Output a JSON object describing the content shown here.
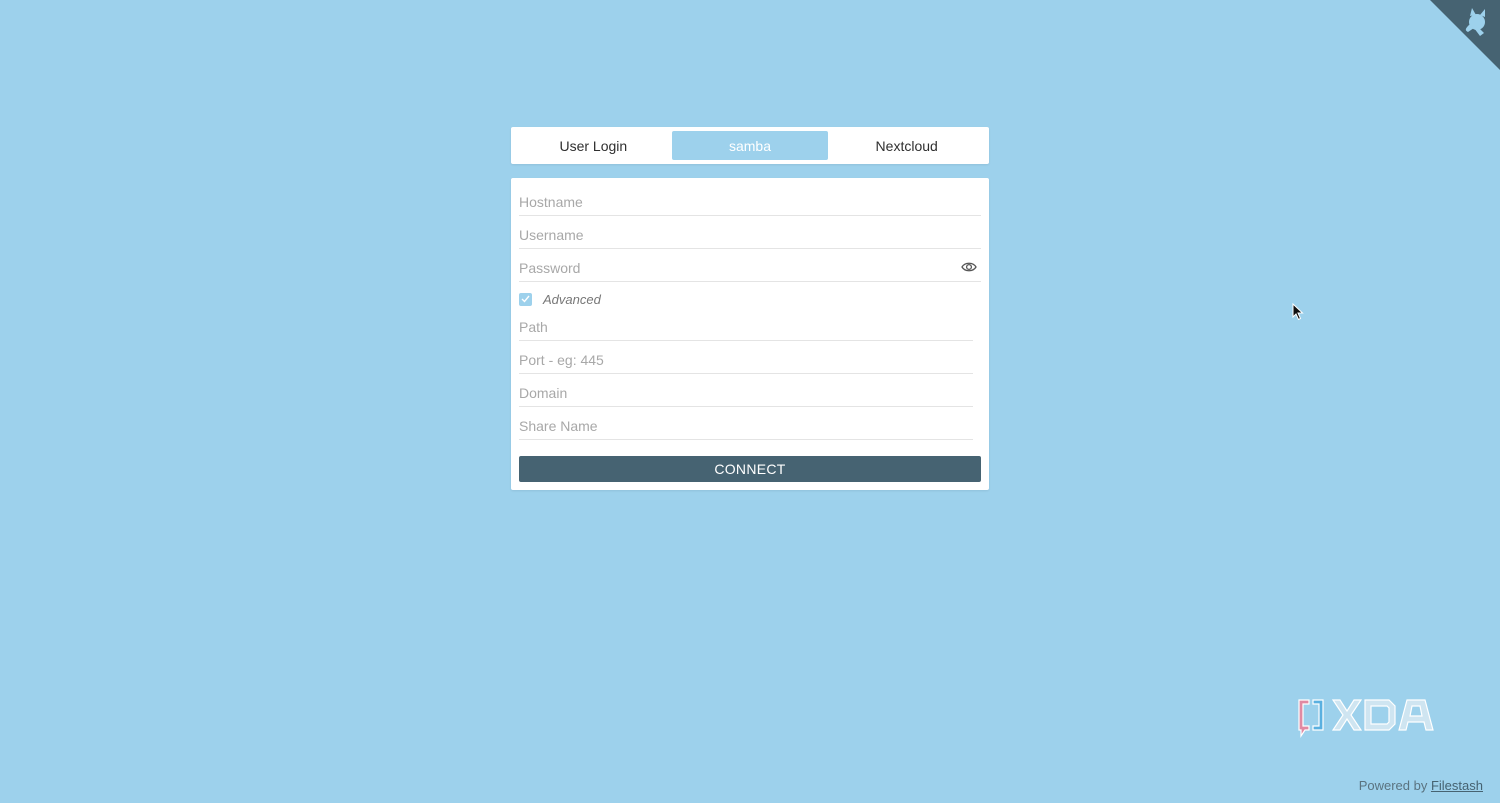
{
  "tabs": [
    {
      "label": "User Login",
      "active": false
    },
    {
      "label": "samba",
      "active": true
    },
    {
      "label": "Nextcloud",
      "active": false
    }
  ],
  "form": {
    "hostname_placeholder": "Hostname",
    "username_placeholder": "Username",
    "password_placeholder": "Password",
    "advanced_label": "Advanced",
    "advanced_checked": true,
    "path_placeholder": "Path",
    "port_placeholder": "Port - eg: 445",
    "domain_placeholder": "Domain",
    "share_placeholder": "Share Name",
    "connect_label": "CONNECT"
  },
  "footer": {
    "powered_text": "Powered by",
    "link_text": "Filestash"
  },
  "icons": {
    "corner": "octocat-corner-icon",
    "eye": "eye-icon",
    "check": "check-icon",
    "watermark": "xda-logo"
  },
  "colors": {
    "background": "#9dd1ec",
    "active_tab": "#9dd1ec",
    "connect_button": "#466372"
  }
}
